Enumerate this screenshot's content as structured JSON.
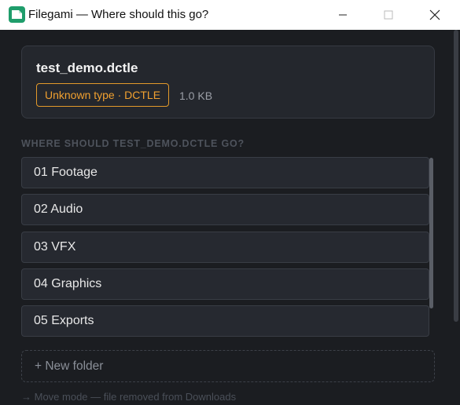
{
  "window": {
    "title": "Filegami — Where should this go?",
    "icon": "filegami-logo-icon",
    "controls": [
      "minimize-icon",
      "maximize-icon",
      "close-icon"
    ]
  },
  "file": {
    "name": "test_demo.dctle",
    "type_badge": "Unknown type · DCTLE",
    "size": "1.0 KB"
  },
  "section_label": "WHERE SHOULD TEST_DEMO.DCTLE GO?",
  "folders": [
    {
      "label": "01 Footage"
    },
    {
      "label": "02 Audio"
    },
    {
      "label": "03 VFX"
    },
    {
      "label": "04 Graphics"
    },
    {
      "label": "05 Exports"
    }
  ],
  "new_folder_label": "+ New folder",
  "footer_note": "→ Move mode — file removed from Downloads",
  "colors": {
    "background": "#1b1d21",
    "card": "#24272d",
    "accent_warning": "#f0a030",
    "brand_green": "#1f9d6b"
  }
}
